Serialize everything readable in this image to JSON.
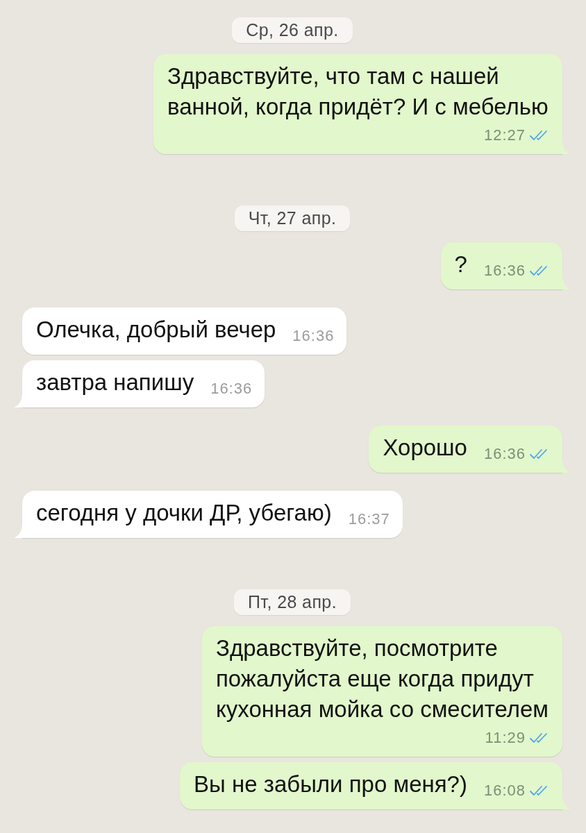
{
  "chat": {
    "items": [
      {
        "kind": "date",
        "text": "Ср, 26 апр."
      },
      {
        "kind": "sent",
        "text": "Здравствуйте, что там с нашей ванной, когда придёт? И с мебелью",
        "time": "12:27",
        "read": true,
        "tail": true
      },
      {
        "kind": "date",
        "text": "Чт, 27 апр."
      },
      {
        "kind": "sent",
        "text": "?",
        "time": "16:36",
        "read": true,
        "tail": true
      },
      {
        "kind": "received",
        "text": "Олечка, добрый вечер",
        "time": "16:36",
        "tail": false
      },
      {
        "kind": "received",
        "text": "завтра напишу",
        "time": "16:36",
        "tail": true
      },
      {
        "kind": "sent",
        "text": "Хорошо",
        "time": "16:36",
        "read": true,
        "tail": true
      },
      {
        "kind": "received",
        "text": "сегодня у дочки ДР, убегаю)",
        "time": "16:37",
        "tail": true
      },
      {
        "kind": "date",
        "text": "Пт, 28 апр."
      },
      {
        "kind": "sent",
        "text": "Здравствуйте, посмотрите пожалуйста еще когда придут кухонная мойка со смесителем",
        "time": "11:29",
        "read": true,
        "tail": false
      },
      {
        "kind": "sent",
        "text": "Вы не забыли про меня?)",
        "time": "16:08",
        "read": true,
        "tail": true
      }
    ]
  }
}
